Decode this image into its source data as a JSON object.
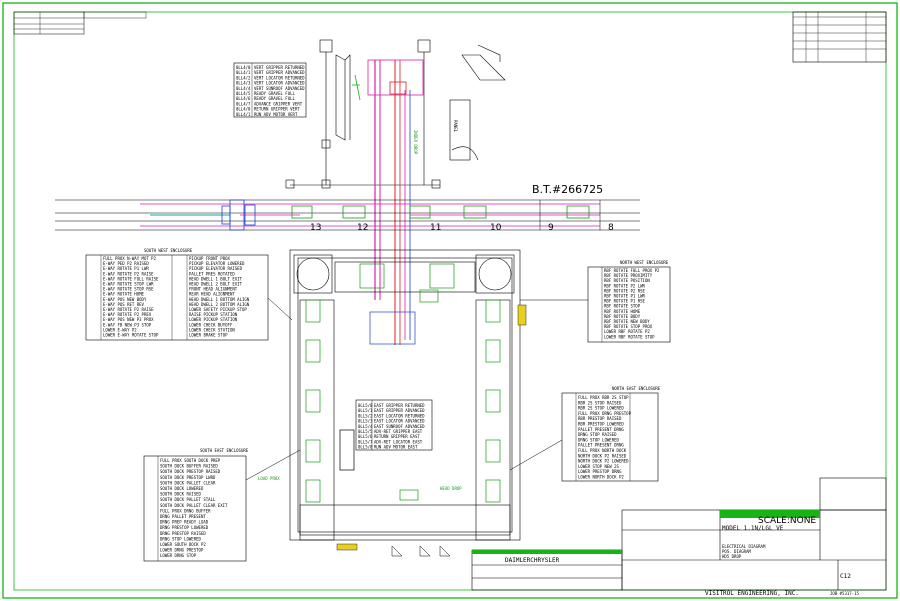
{
  "title_block": {
    "company": "VISITROL ENGINEERING, INC.",
    "job": "JOB #5317-15",
    "client": "DAIMLERCHRYSLER",
    "scale": "SCALE:NONE",
    "model": "MODEL 1.1N/LGL VE",
    "sheet_no": "C12",
    "drawing_title": "ELECTRICAL DIAGRAM",
    "zone": "POS. DIAGRAM",
    "drop": "HD5 DROP"
  },
  "bt_number": "B.T.#266725",
  "station_numbers": [
    "13",
    "12",
    "11",
    "10",
    "9",
    "8"
  ],
  "north_east_header": "NORTH EAST ENCLOSURE",
  "south_west_header": "SOUTH WEST ENCLOSURE",
  "south_east_header": "SOUTH EAST ENCLOSURE",
  "north_west_header": "NORTH WEST ENCLOSURE",
  "legend_top": [
    "VERT GRIPPER RETURNED",
    "VERT GRIPPER ADVANCED",
    "VERT LOCATOR RETURNED",
    "VERT LOCATOR ADVANCED",
    "VERT SUNROOF ADVANCED",
    "READY GRAVEL FULL",
    "READY GRAVEL FULL",
    "ADVANCE GRIPPER VERT",
    "RETURN GRIPPER VERT",
    "RUN ADV MOTOR VERT"
  ],
  "legend_top_codes": [
    "0LL4/0",
    "0LL4/1",
    "0LL4/2",
    "0LL4/3",
    "0LL4/4",
    "0LL4/5",
    "0LL4/6",
    "0LL4/7",
    "0LL4/0",
    "0LL4/1"
  ],
  "legend_east": [
    "EAST GRIPPER RETURNED",
    "EAST GRIPPER ADVANCED",
    "EAST LOCATOR RETURNED",
    "EAST LOCATOR ADVANCED",
    "EAST SUNROOF ADVANCED",
    "ADV-RET GRIPPER EAST",
    "RETURN GRIPPER EAST",
    "ADV-RET LOCATOR EAST",
    "RUN ADV MOTOR EAST"
  ],
  "legend_east_codes": [
    "0LL5/0",
    "0LL5/1",
    "0LL5/2",
    "0LL5/3",
    "0LL5/4",
    "0LL5/5",
    "0LL5/6",
    "0LL5/7",
    "0LL5/0"
  ],
  "legend_sw": [
    "FULL PROX N-WAY MOT P2",
    "E-WAY PED P2 RAISED",
    "E-WAY ROTATE P1 LWR",
    "E-WAY ROTATE P2 RAISE",
    "E-WAY ROTATE FULL RAISE",
    "E-WAY ROTATE STOP LWR",
    "E-WAY ROTATE STOP RSE",
    "E-WAY ROTATE HOME",
    "E-WAY POS NEW BODY",
    "E-WAY POS RET REV",
    "E-WAY ROTATE P2 RAISE",
    "E-WAY ROTATE P2 PREV",
    "E-WAY POS NEW P3 PROX",
    "E-WAY FB NEW P3 STOP",
    "LOWER E-WAY P2",
    "LOWER E-WAY ROTATE STOP"
  ],
  "legend_sw2": [
    "PICKUP FRONT PROX",
    "PICKUP ELEVATOR LOWERED",
    "PICKUP ELEVATOR RAISED",
    "PALLET PRES ROTATED",
    "HEAD DWELL 1 BOLT EXIT",
    "HEAD DWELL 2 BOLT EXIT",
    "FRONT HEAD ALIGNMENT",
    "REAR HEAD ALIGNMENT",
    "HEAD DWELL 1 BOTTOM ALIGN",
    "HEAD DWELL 2 BOTTOM ALIGN",
    "LOWER SAFETY PICKUP STOP",
    "RAISE PICKUP STATION",
    "LOWER PICKUP STATION",
    "LOWER CHECK BUYOFF",
    "LOWER CHECK STATION",
    "LOWER BRAKE STOP"
  ],
  "legend_ne": [
    "RBF ROTATE FULL PROX P2",
    "RBF ROTATE PROXIMITY",
    "RBF ROTATE POSITION",
    "RBF ROTATE P2 LWR",
    "RBF ROTATE P2 RSE",
    "RBF ROTATE P1 LWR",
    "RBF ROTATE P1 RSE",
    "RBF ROTATE STOP",
    "RBF ROTATE HOME",
    "RBF ROTATE BODY",
    "RBF ROTATE NEW BODY",
    "RBF ROTATE STOP PROX",
    "LOWER RBF ROTATE P2",
    "LOWER RBF ROTATE STOP"
  ],
  "legend_se": [
    "FULL PROX SOUTH DOCK PREP",
    "SOUTH DOCK BUFFER RAISED",
    "SOUTH DOCK PRESTOP RAISED",
    "SOUTH DOCK PRESTOP LWRD",
    "SOUTH DOCK PALLET CLEAR",
    "SOUTH DOCK LOWERED",
    "SOUTH DOCK RAISED",
    "SOUTH DOCK PALLET STALL",
    "SOUTH DOCK PALLET CLEAR EXIT",
    "FULL PROX DRNG BUFFER",
    "DRNG PALLET PRESENT",
    "DRNG PREP READY LOAD",
    "DRNG PRESTOP LOWERED",
    "DRNG PRESTOP RAISED",
    "DRNG STOP LOWERED",
    "LOWER SOUTH DOCK P2",
    "LOWER DRNG PRESTOP",
    "LOWER DRNG STOP"
  ],
  "legend_nee": [
    "FULL PROX RBR 2S STOP",
    "RBR 2S STOP RAISED",
    "RBR 2S STOP LOWERED",
    "FULL PROX DRNG PRESTOP",
    "RBR PRESTOP RAISED",
    "RBR PRESTOP LOWERED",
    "PALLET PRESENT DRNG",
    "DRNG STOP RAISED",
    "DRNG STOP LOWERED",
    "PALLET PRESENT DRNG",
    "FULL PROX NORTH DOCK",
    "NORTH DOCK P2 RAISED",
    "NORTH DOCK P2 LOWERED",
    "LOWER STOP NEW 2S",
    "LOWER PRESTOP DRNG",
    "LOWER NORTH DOCK P2"
  ],
  "callouts": {
    "load_prox": "LOAD PROX",
    "head_drop": "HEAD DROP",
    "index_drop": "INDEX DROP"
  },
  "colors": {
    "border": "#16b416",
    "conveyor": "#000000",
    "pink": "#d81fb0",
    "red": "#e01f1f",
    "blue": "#1f3fd8",
    "cyan": "#10a8a8",
    "yellow": "#e8d020",
    "green": "#1a9a1a"
  }
}
